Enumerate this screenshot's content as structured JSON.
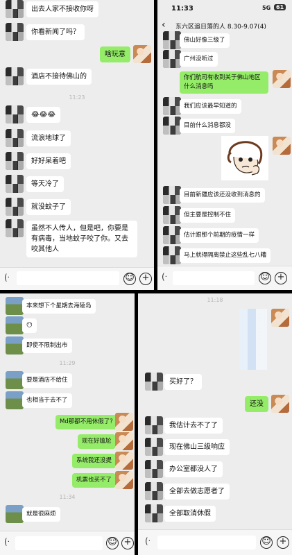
{
  "colors": {
    "green_bubble": "#95ec69",
    "chat_bg": "#ededed",
    "divider": "#000000"
  },
  "panel1": {
    "messages": [
      {
        "side": "left",
        "text": "出去人家不接收你呀"
      },
      {
        "side": "left",
        "text": "你看新闻了吗？"
      },
      {
        "side": "right",
        "text": "啥玩意"
      },
      {
        "side": "left",
        "text": "酒店不接待佛山的"
      },
      {
        "side": "left",
        "text": "😂😂😂"
      },
      {
        "side": "left",
        "text": "流浪地球了"
      },
      {
        "side": "left",
        "text": "好好呆着吧"
      },
      {
        "side": "left",
        "text": "等天冷了"
      },
      {
        "side": "left",
        "text": "就没蚊子了"
      },
      {
        "side": "left",
        "text": "虽然不人传人，但是吧，你要是有病毒，当地蚊子咬了你。又去咬其他人"
      }
    ],
    "timestamp": "11:23",
    "icons": [
      "voice-icon",
      "emoji-icon",
      "plus-icon"
    ]
  },
  "panel2": {
    "status_time": "11:33",
    "status_signal": "5G",
    "status_battery": "61",
    "title": "东六区追日落的人 8.30-9.07(4)",
    "messages": [
      {
        "side": "left",
        "text": "佛山好像三级了"
      },
      {
        "side": "left",
        "text": "广州没听过"
      },
      {
        "side": "right",
        "text": "你们航司有收到关于佛山地区什么消息吗"
      },
      {
        "side": "left",
        "text": "我们应该最早知道的"
      },
      {
        "side": "left",
        "text": "目前什么消息都没"
      },
      {
        "side": "right",
        "text": "[表情]"
      },
      {
        "side": "left",
        "text": "目前新疆应该还没收到消息的"
      },
      {
        "side": "left",
        "text": "但主要是控制不住"
      },
      {
        "side": "left",
        "text": "估计跟那个前期的疫情一样"
      },
      {
        "side": "left",
        "text": "马上就得隔离禁止这些乱七八糟"
      }
    ]
  },
  "panel3": {
    "messages": [
      {
        "side": "left",
        "text": "本来想下个星期去海陵岛"
      },
      {
        "side": "left",
        "text": "😶"
      },
      {
        "side": "left",
        "text": "即使不限制出市"
      },
      {
        "side": "left",
        "text": "要是酒店不给住"
      },
      {
        "side": "left",
        "text": "也相当于去不了"
      },
      {
        "side": "right",
        "text": "Md那都不用休假了？"
      },
      {
        "side": "right",
        "text": "现在好尴尬"
      },
      {
        "side": "right",
        "text": "系统我还没提"
      },
      {
        "side": "right",
        "text": "机票也买不了"
      },
      {
        "side": "left",
        "text": "就是很麻烦"
      }
    ],
    "timestamps": [
      "11:29",
      "11:34"
    ]
  },
  "panel4": {
    "timestamp": "11:18",
    "messages": [
      {
        "side": "left",
        "text": "买好了？"
      },
      {
        "side": "right",
        "text": "还没"
      },
      {
        "side": "left",
        "text": "我估计去不了了"
      },
      {
        "side": "left",
        "text": "现在佛山三级响应"
      },
      {
        "side": "left",
        "text": "办公室都没人了"
      },
      {
        "side": "left",
        "text": "全部去做志愿者了"
      },
      {
        "side": "left",
        "text": "全部取消休假"
      }
    ]
  }
}
